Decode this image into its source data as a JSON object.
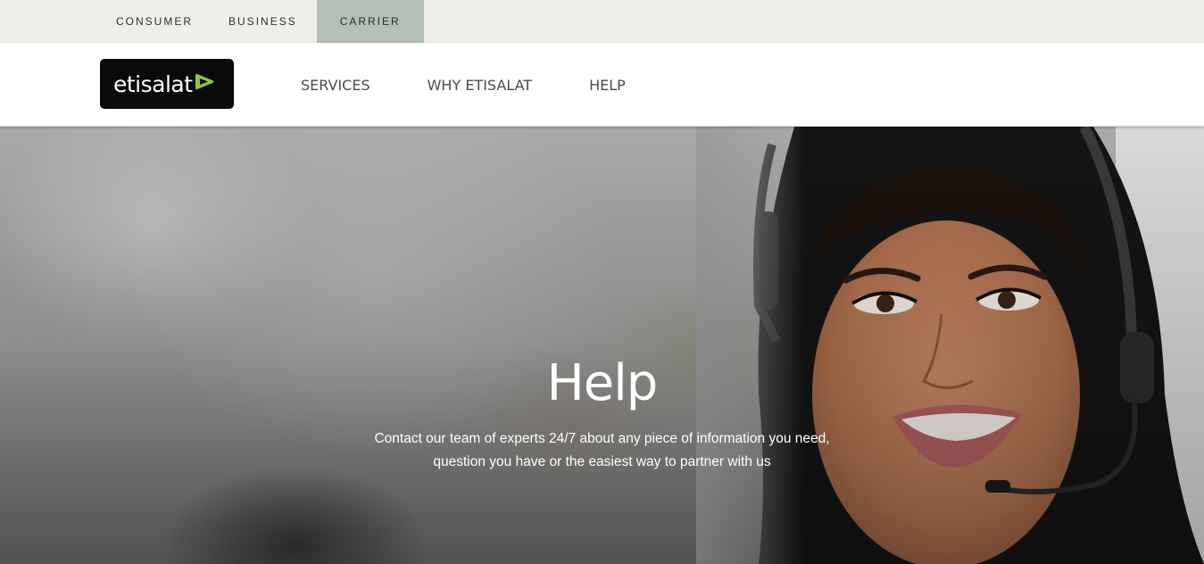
{
  "segments": {
    "items": [
      {
        "label": "CONSUMER"
      },
      {
        "label": "BUSINESS"
      },
      {
        "label": "CARRIER",
        "active": true
      }
    ]
  },
  "header": {
    "logo_text": "etisalat",
    "nav": [
      {
        "label": "SERVICES"
      },
      {
        "label": "WHY ETISALAT"
      },
      {
        "label": "HELP"
      }
    ]
  },
  "hero": {
    "title": "Help",
    "subtitle_line1": "Contact our team of experts 24/7 about any piece of information you need,",
    "subtitle_line2": "question you have or the easiest way to partner with us"
  },
  "colors": {
    "segment_bar": "#efefe9",
    "segment_active": "#b3bfb7",
    "logo_bg": "#0a0a0a",
    "logo_accent": "#8cc63f"
  }
}
